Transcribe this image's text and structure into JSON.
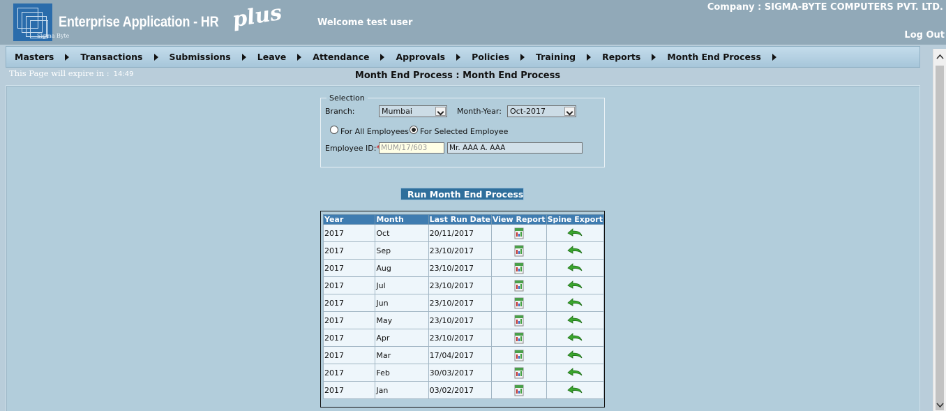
{
  "header": {
    "logo_sub": "Sigma Byte",
    "app_title": "Enterprise Application - HR",
    "app_plus": "plus",
    "welcome": "Welcome test user",
    "company": "Company : SIGMA-BYTE COMPUTERS PVT. LTD.",
    "logout": "Log Out"
  },
  "menu": [
    {
      "label": "Masters"
    },
    {
      "label": "Transactions"
    },
    {
      "label": "Submissions"
    },
    {
      "label": "Leave"
    },
    {
      "label": "Attendance"
    },
    {
      "label": "Approvals"
    },
    {
      "label": "Policies"
    },
    {
      "label": "Training"
    },
    {
      "label": "Reports"
    },
    {
      "label": "Month End Process"
    }
  ],
  "expire": {
    "label": "This Page will expire in :",
    "time": "14:49"
  },
  "page_title": "Month End Process : Month End Process",
  "selection": {
    "legend": "Selection",
    "branch_label": "Branch:",
    "branch_value": "Mumbai",
    "month_year_label": "Month-Year:",
    "month_year_value": "Oct-2017",
    "radio_all_label": "For All Employees",
    "radio_selected_label": "For Selected Employee",
    "selected_radio": "For Selected Employee",
    "employee_id_label": "Employee ID:",
    "required_mark": "*",
    "employee_id_placeholder": "MUM/17/603",
    "employee_name": "Mr. AAA A. AAA"
  },
  "run_button": {
    "label": "Run Month End Process",
    "icon": "run-process-icon"
  },
  "table": {
    "columns": [
      "Year",
      "Month",
      "Last Run Date",
      "View Report",
      "Spine Export"
    ],
    "rows": [
      {
        "year": "2017",
        "month": "Oct",
        "last_run": "20/11/2017"
      },
      {
        "year": "2017",
        "month": "Sep",
        "last_run": "23/10/2017"
      },
      {
        "year": "2017",
        "month": "Aug",
        "last_run": "23/10/2017"
      },
      {
        "year": "2017",
        "month": "Jul",
        "last_run": "23/10/2017"
      },
      {
        "year": "2017",
        "month": "Jun",
        "last_run": "23/10/2017"
      },
      {
        "year": "2017",
        "month": "May",
        "last_run": "23/10/2017"
      },
      {
        "year": "2017",
        "month": "Apr",
        "last_run": "23/10/2017"
      },
      {
        "year": "2017",
        "month": "Mar",
        "last_run": "17/04/2017"
      },
      {
        "year": "2017",
        "month": "Feb",
        "last_run": "30/03/2017"
      },
      {
        "year": "2017",
        "month": "Jan",
        "last_run": "03/02/2017"
      }
    ],
    "view_icon": "report-icon",
    "export_icon": "export-arrow-icon"
  },
  "colors": {
    "header_bg": "#91a9b8",
    "body_bg": "#b9cdda",
    "table_header": "#3f7cb0",
    "button_bg": "#2f6f9c",
    "required": "#d00000"
  }
}
